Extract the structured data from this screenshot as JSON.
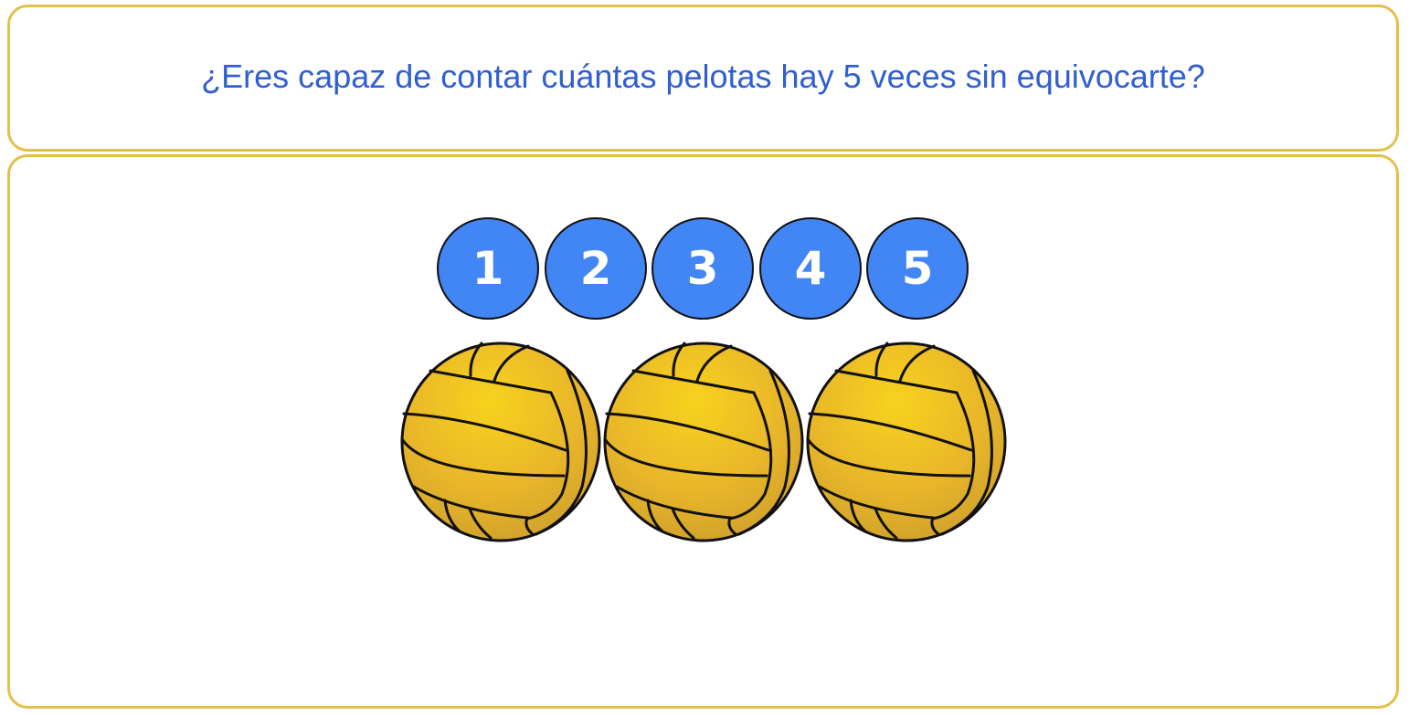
{
  "header": {
    "question": "¿Eres capaz de contar cuántas pelotas hay 5 veces sin equivocarte?"
  },
  "counters": [
    {
      "label": "1"
    },
    {
      "label": "2"
    },
    {
      "label": "3"
    },
    {
      "label": "4"
    },
    {
      "label": "5"
    }
  ],
  "balls": {
    "count": 3,
    "icon": "water-polo-ball-icon"
  },
  "colors": {
    "panel_border": "#e3c04a",
    "question_text": "#2f5fd0",
    "counter_fill": "#4285f4",
    "ball_fill": "#f2c21a"
  }
}
